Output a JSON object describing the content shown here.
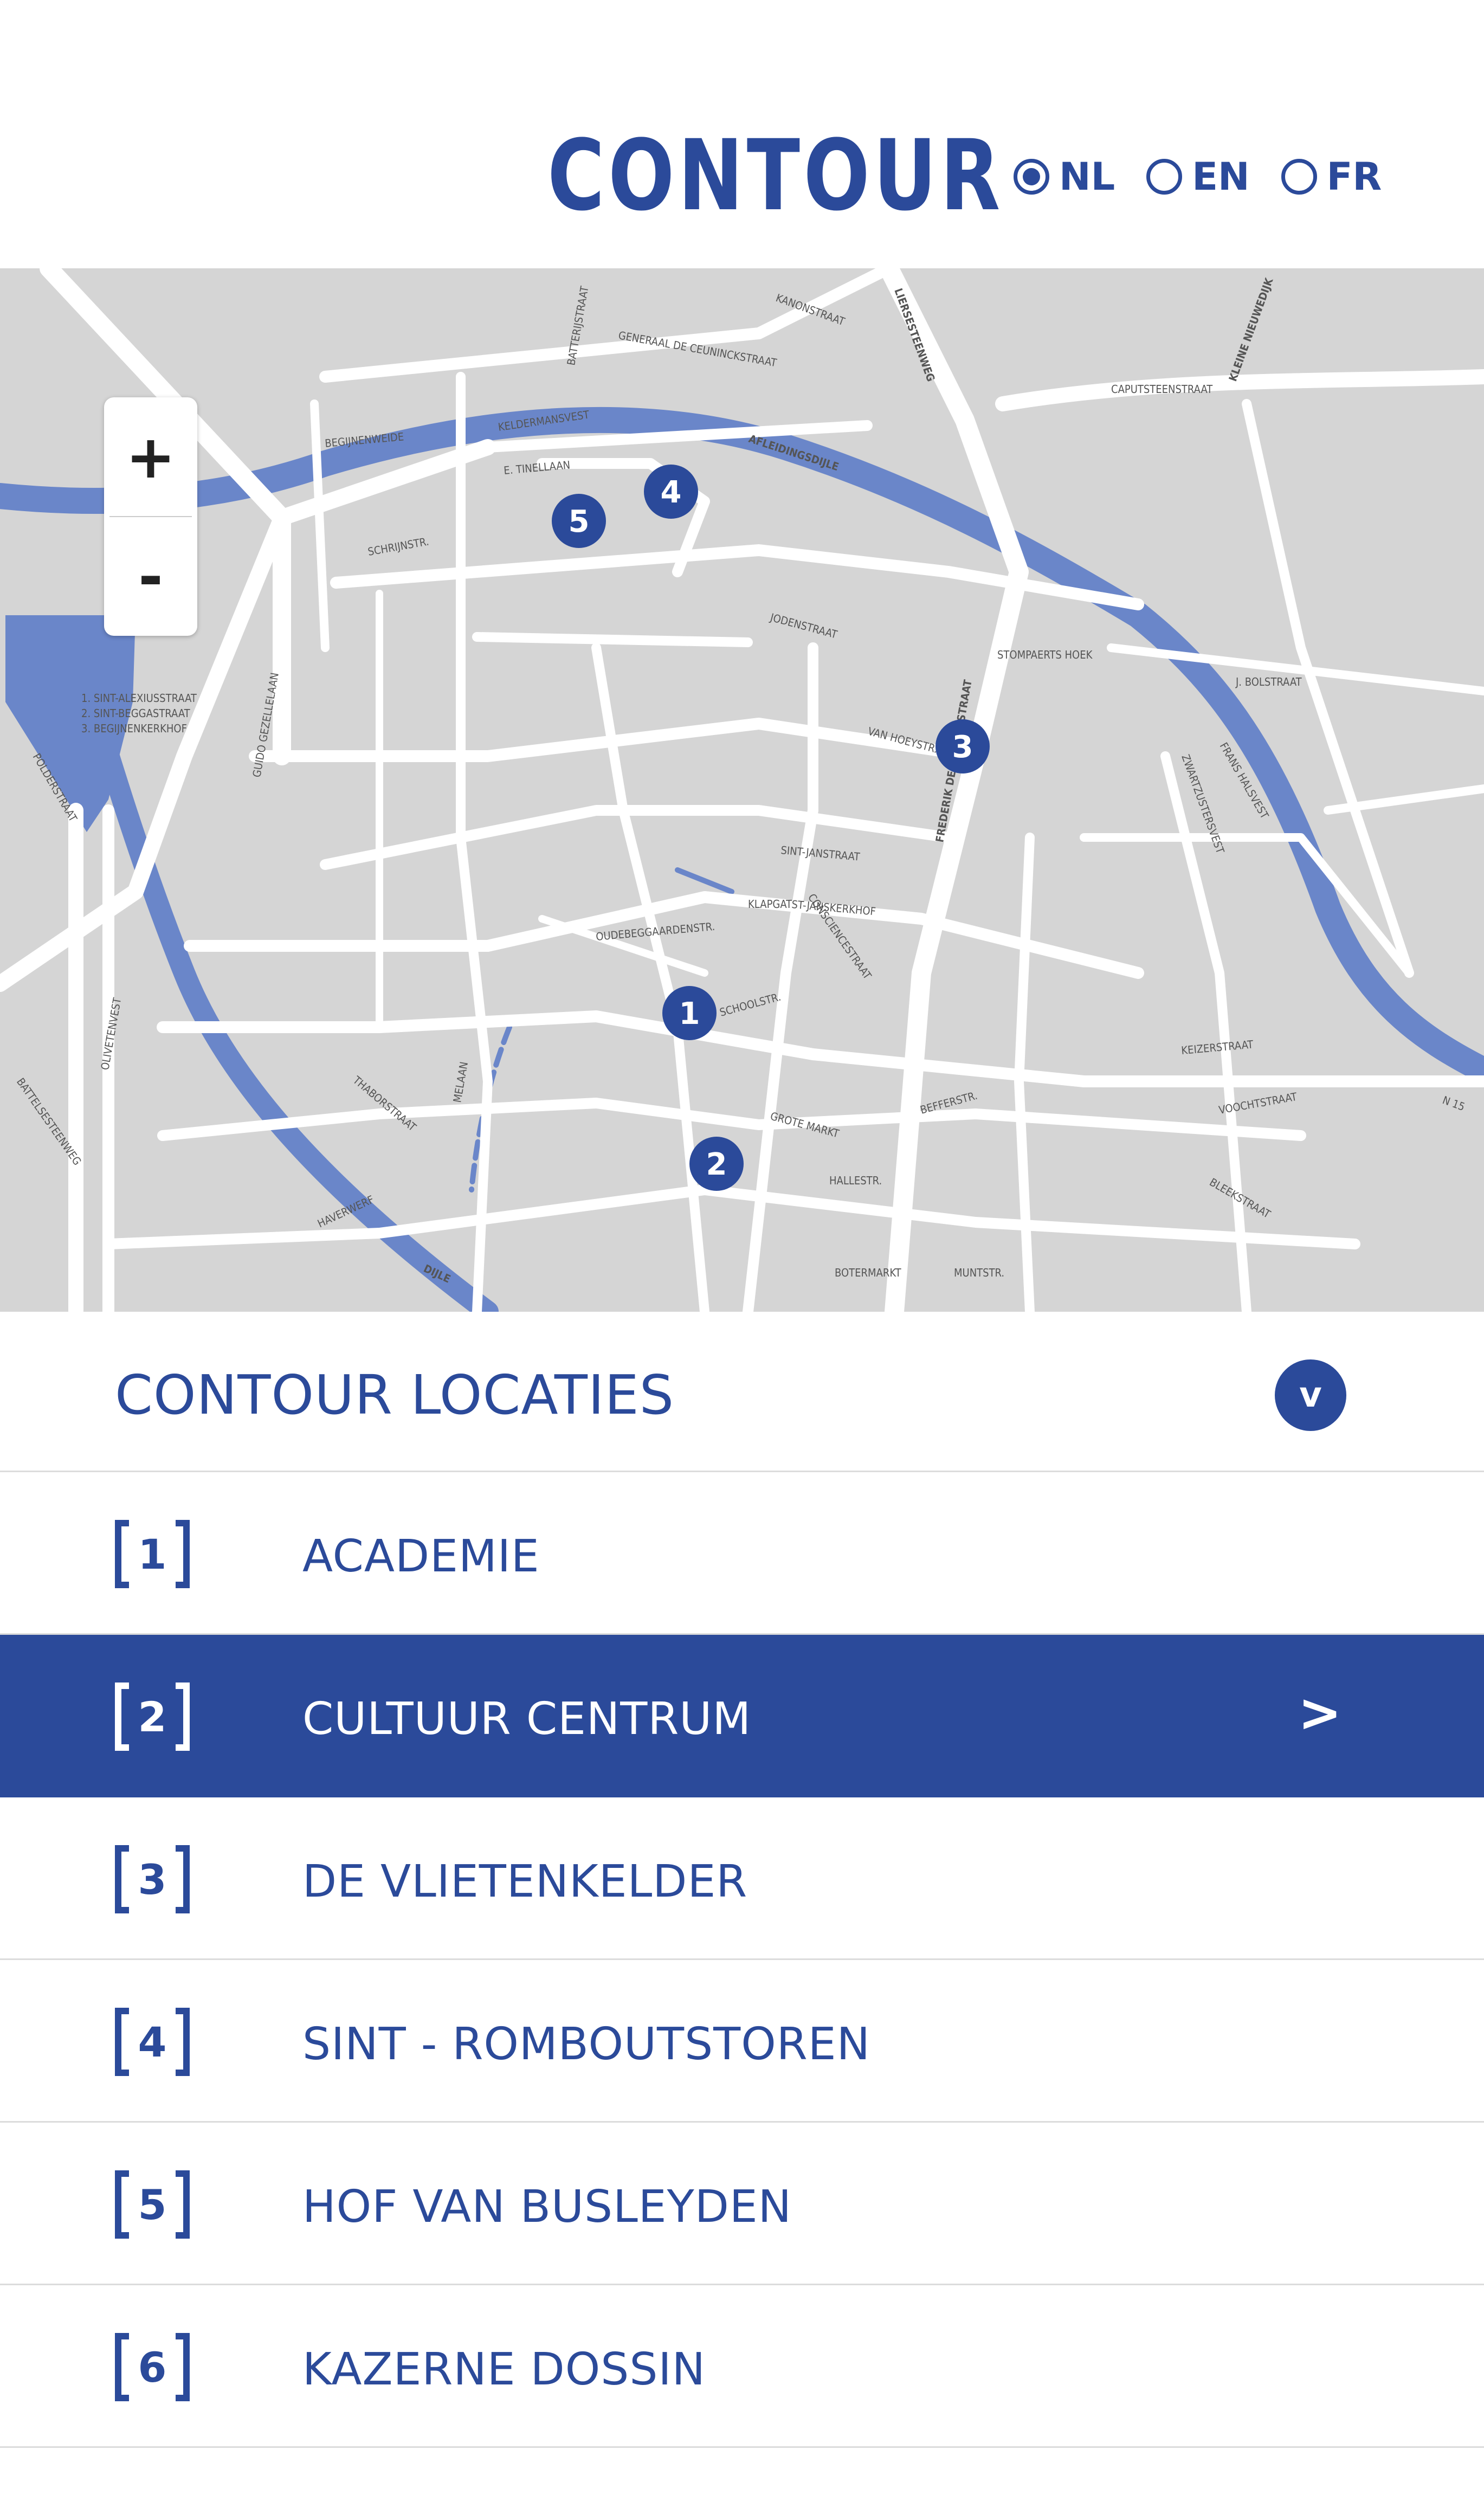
{
  "header": {
    "logo": "CONTOUR",
    "languages": [
      {
        "label": "NL",
        "selected": true
      },
      {
        "label": "EN",
        "selected": false
      },
      {
        "label": "FR",
        "selected": false
      }
    ]
  },
  "map": {
    "zoom_in": "+",
    "zoom_out": "-",
    "pins": [
      "1",
      "2",
      "3",
      "4",
      "5"
    ],
    "legend_lines": [
      "1. SINT-ALEXIUSSTRAAT",
      "2. SINT-BEGGASTRAAT",
      "3. BEGIJNENKERKHOF"
    ],
    "street_labels": [
      "CAPUTSTEENSTRAAT",
      "KELDERMANSVEST",
      "AFLEIDINGSDIJLE",
      "E. TINELLAAN",
      "GENERAAL DE CEUNINCKSTRAAT",
      "LIERSESTEENWEG",
      "KLEINE NIEUWEDIJK",
      "BATTERIJSTRAAT",
      "BEGIJNENWEIDE",
      "GUIDO GEZELLELAAN",
      "POLDERSTRAAT",
      "OLIVETENVEST",
      "BATTELSESTEENWEG",
      "FREDERIK DE MERODESTRAAT",
      "VAN HOEYSTR.",
      "ZWARTZUSTERSVEST",
      "FRANS HALSVEST",
      "J. BOLSTRAAT",
      "STOMPAERTS HOEK",
      "JODENSTRAAT",
      "SCHRIJNSTR.",
      "KEIZERSTRAAT",
      "VOOCHTSTRAAT",
      "BLEEKSTRAAT",
      "HALLESTR.",
      "BEFFERSTR.",
      "MUNTSTR.",
      "BOTERMARKT",
      "GROTE MARKT",
      "SCHOOLSTR.",
      "DIJLE",
      "HAVERWERF",
      "THABORSTRAAT",
      "N 15",
      "CONSCIENCESTRAAT",
      "KLAPGAT",
      "ST-JANSKERKHOF",
      "SINT-JANSTRAAT",
      "OUDEBEGGAARDENSTR.",
      "MELAAN",
      "KANONSTRAAT"
    ]
  },
  "locaties": {
    "title": "CONTOUR LOCATIES",
    "toggle": "v",
    "items": [
      {
        "num": "1",
        "label": "ACADEMIE",
        "active": false
      },
      {
        "num": "2",
        "label": "CULTUUR CENTRUM",
        "active": true,
        "arrow": ">"
      },
      {
        "num": "3",
        "label": "DE VLIETENKELDER",
        "active": false
      },
      {
        "num": "4",
        "label": "SINT - ROMBOUTSTOREN",
        "active": false
      },
      {
        "num": "5",
        "label": "HOF VAN BUSLEYDEN",
        "active": false
      },
      {
        "num": "6",
        "label": "KAZERNE DOSSIN",
        "active": false
      }
    ]
  },
  "colors": {
    "brand": "#2b4a9a",
    "water": "#6a86c9",
    "map_bg": "#d5d5d5",
    "road": "#ffffff"
  }
}
